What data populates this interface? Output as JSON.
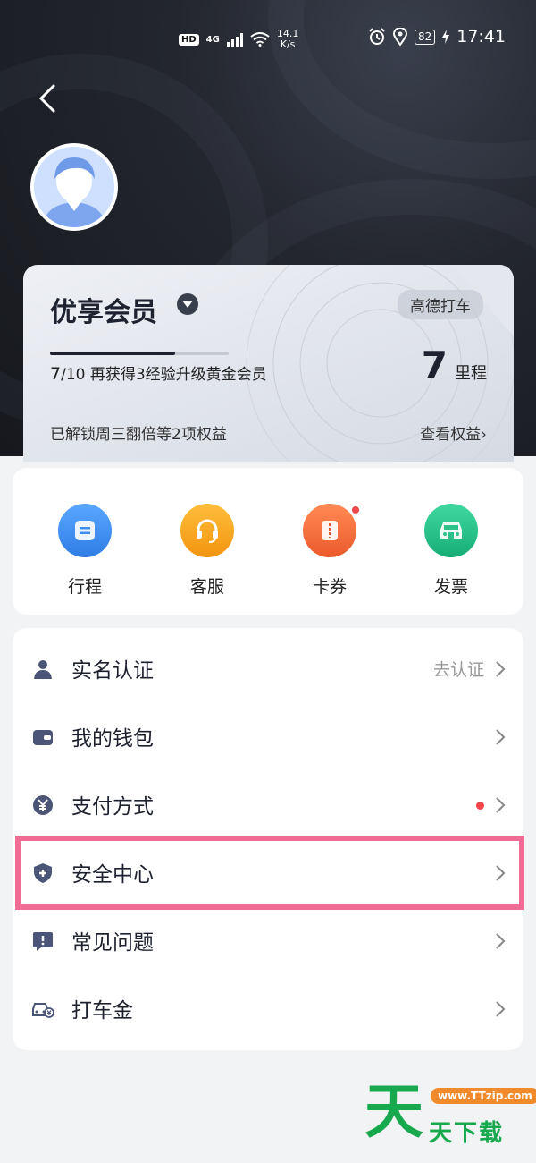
{
  "status_bar": {
    "hd": "HD",
    "network": "4G",
    "speed_value": "14.1",
    "speed_unit": "K/s",
    "battery": "82",
    "time": "17:41"
  },
  "member_card": {
    "title": "优享会员",
    "badge": "高德打车",
    "progress": {
      "current": 7,
      "total": 10,
      "fraction": 0.7
    },
    "exp_current": "7",
    "exp_total": "/10",
    "exp_text": "再获得3经验升级黄金会员",
    "mileage_value": "7",
    "mileage_unit": "里程",
    "unlock_text": "已解锁周三翻倍等2项权益",
    "view_rights": "查看权益›"
  },
  "quick_actions": [
    {
      "label": "行程",
      "icon": "trip-icon",
      "color": "#3f8ff0"
    },
    {
      "label": "客服",
      "icon": "headset-icon",
      "color": "#f5a31b"
    },
    {
      "label": "卡券",
      "icon": "coupon-icon",
      "color": "#f26a3d",
      "has_dot": true
    },
    {
      "label": "发票",
      "icon": "invoice-car-icon",
      "color": "#2cc28a"
    }
  ],
  "menu": [
    {
      "label": "实名认证",
      "icon": "user-icon",
      "hint": "去认证"
    },
    {
      "label": "我的钱包",
      "icon": "wallet-icon"
    },
    {
      "label": "支付方式",
      "icon": "yuan-icon",
      "has_dot": true
    },
    {
      "label": "安全中心",
      "icon": "shield-icon",
      "highlighted": true
    },
    {
      "label": "常见问题",
      "icon": "faq-icon"
    },
    {
      "label": "打车金",
      "icon": "car-money-icon"
    }
  ],
  "watermark": {
    "big_char": "天",
    "url": "www.TTzip.com",
    "text": "天下载"
  },
  "colors": {
    "header_bg": "#1d2026",
    "menu_icon": "#4a5578",
    "highlight_border": "#f06c94",
    "red_dot": "#f2464a",
    "watermark_green": "#18a84d"
  }
}
